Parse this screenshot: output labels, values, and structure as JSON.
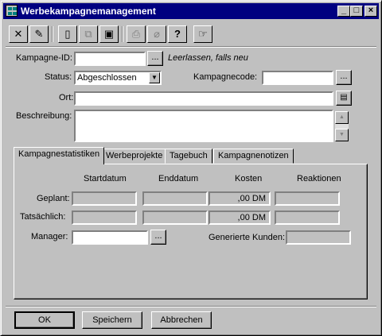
{
  "window": {
    "title": "Werbekampagnemanagement"
  },
  "title_buttons": {
    "minimize": "_",
    "maximize": "□",
    "close": "×"
  },
  "toolbar": {
    "items": [
      {
        "icon": "cancel-x-icon",
        "glyph": "✕"
      },
      {
        "icon": "eraser-icon",
        "glyph": "✎"
      },
      {
        "icon": "new-document-icon",
        "glyph": "▯"
      },
      {
        "icon": "copy-document-icon",
        "glyph": "⧉"
      },
      {
        "icon": "save-disk-icon",
        "glyph": "▣"
      },
      {
        "icon": "print-icon",
        "glyph": "⎙"
      },
      {
        "icon": "paperclip-icon",
        "glyph": "⌀"
      },
      {
        "icon": "help-icon",
        "glyph": "?"
      },
      {
        "icon": "hand-pointer-icon",
        "glyph": "☞"
      }
    ]
  },
  "form": {
    "kampagne_id": {
      "label": "Kampagne-ID:",
      "value": "",
      "hint": "Leerlassen, falls neu"
    },
    "status": {
      "label": "Status:",
      "value": "Abgeschlossen"
    },
    "kampagnecode": {
      "label": "Kampagnecode:",
      "value": ""
    },
    "ort": {
      "label": "Ort:",
      "value": ""
    },
    "beschreibung": {
      "label": "Beschreibung:",
      "value": ""
    },
    "browse": "..."
  },
  "tabs": [
    {
      "label": "Kampagnestatistiken",
      "active": true
    },
    {
      "label": "Werbeprojekte",
      "active": false
    },
    {
      "label": "Tagebuch",
      "active": false
    },
    {
      "label": "Kampagnenotizen",
      "active": false
    }
  ],
  "stats": {
    "columns": [
      "Startdatum",
      "Enddatum",
      "Kosten",
      "Reaktionen"
    ],
    "rows": [
      {
        "label": "Geplant:",
        "start": "",
        "end": "",
        "cost": ",00 DM",
        "reactions": ""
      },
      {
        "label": "Tatsächlich:",
        "start": "",
        "end": "",
        "cost": ",00 DM",
        "reactions": ""
      }
    ],
    "manager_label": "Manager:",
    "manager_value": "",
    "generated_label": "Generierte Kunden:",
    "generated_value": ""
  },
  "buttons": {
    "ok": "OK",
    "save": "Speichern",
    "cancel": "Abbrechen"
  },
  "colors": {
    "titlebar": "#000080",
    "face": "#c0c0c0"
  }
}
